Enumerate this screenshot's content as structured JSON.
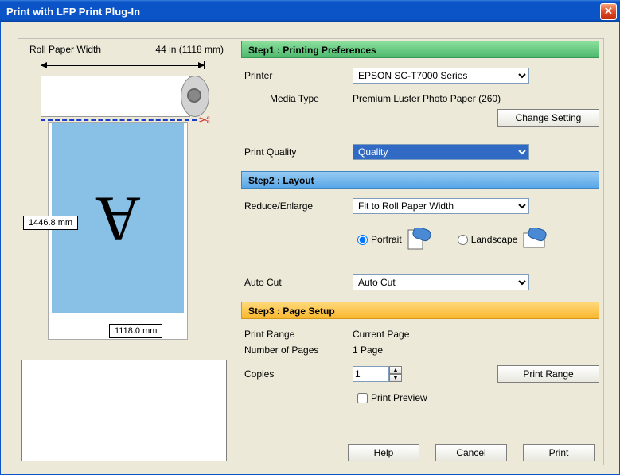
{
  "title": "Print with LFP Print Plug-In",
  "roll_label": "Roll Paper Width",
  "roll_value": "44 in (1118 mm)",
  "preview_height": "1446.8 mm",
  "preview_width": "1118.0 mm",
  "step1": {
    "heading": "Step1 : Printing Preferences",
    "printer_label": "Printer",
    "printer_value": "EPSON SC-T7000 Series",
    "media_type_label": "Media Type",
    "media_type_value": "Premium Luster Photo Paper (260)",
    "change_setting": "Change Setting",
    "print_quality_label": "Print Quality",
    "print_quality_value": "Quality"
  },
  "step2": {
    "heading": "Step2 : Layout",
    "reduce_enlarge_label": "Reduce/Enlarge",
    "reduce_enlarge_value": "Fit to Roll Paper Width",
    "portrait_label": "Portrait",
    "landscape_label": "Landscape",
    "auto_cut_label": "Auto Cut",
    "auto_cut_value": "Auto Cut"
  },
  "step3": {
    "heading": "Step3 : Page Setup",
    "print_range_label": "Print Range",
    "print_range_value": "Current Page",
    "num_pages_label": "Number of Pages",
    "num_pages_value": "1 Page",
    "copies_label": "Copies",
    "copies_value": "1",
    "print_range_btn": "Print Range",
    "print_preview_label": "Print Preview"
  },
  "buttons": {
    "help": "Help",
    "cancel": "Cancel",
    "print": "Print"
  }
}
